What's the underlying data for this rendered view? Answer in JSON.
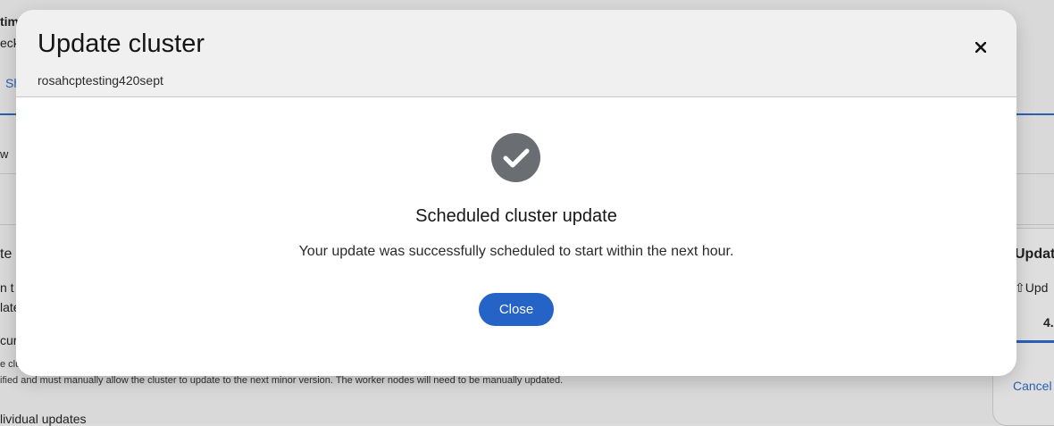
{
  "background": {
    "fragments": {
      "f1": "timi",
      "f2": "eck",
      "f3": "Sh",
      "f4": "w",
      "f5": "te",
      "f6": "n t",
      "f7": "late",
      "f8": "cur",
      "f9": "e clu",
      "f10": "ified and must manually allow the cluster to update to the next minor version. The worker nodes will need to be manually updated.",
      "f11": "lividual updates",
      "f12": "Updat",
      "f13": "Upd",
      "f14": "4.",
      "f15": "Cancel"
    }
  },
  "modal": {
    "title": "Update cluster",
    "subtitle": "rosahcptesting420sept",
    "close_icon": "close-icon",
    "status_icon": "check-circle-icon",
    "heading": "Scheduled cluster update",
    "message": "Your update was successfully scheduled to start within the next hour.",
    "close_button_label": "Close",
    "colors": {
      "primary": "#2563c7",
      "icon": "#6a6e73"
    }
  }
}
